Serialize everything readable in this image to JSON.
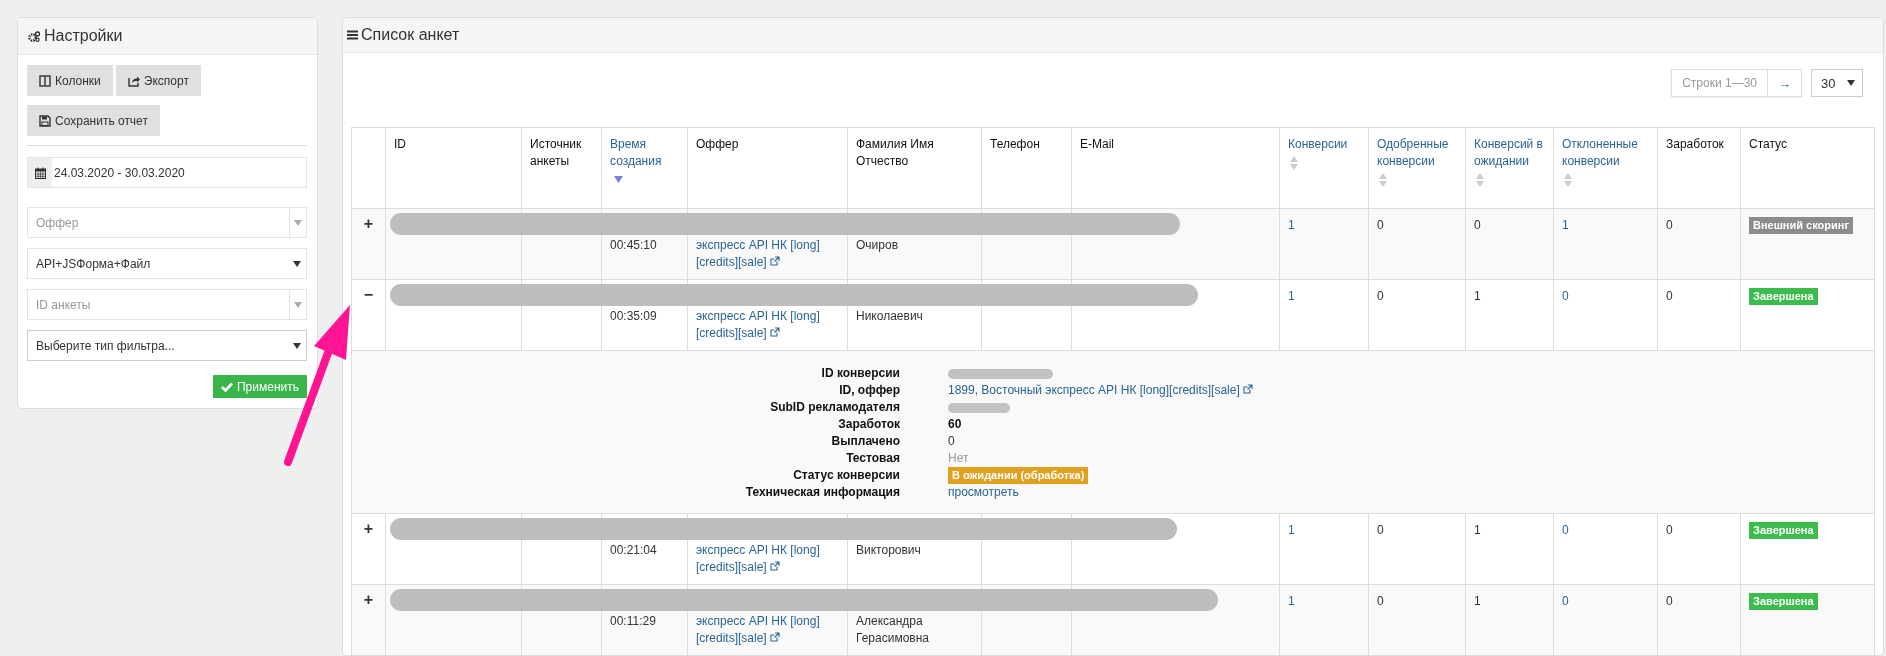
{
  "settings": {
    "title": "Настройки",
    "buttons": [
      {
        "label": "Колонки"
      },
      {
        "label": "Экспорт"
      },
      {
        "label": "Сохранить отчет"
      }
    ],
    "date_range": {
      "value": "24.03.2020 - 30.03.2020"
    },
    "filters": [
      {
        "kind": "search-select",
        "placeholder": "Оффер"
      },
      {
        "kind": "select",
        "value": "API+JSФорма+Файл"
      },
      {
        "kind": "search-select",
        "placeholder": "ID анкеты"
      },
      {
        "kind": "select",
        "value": "Выберите тип фильтра..."
      }
    ],
    "apply_button": "Применить"
  },
  "list": {
    "title": "Список анкет",
    "pager": {
      "label": "Строки 1—30",
      "next": "→"
    },
    "page_size": "30",
    "columns": [
      {},
      {
        "label": "ID"
      },
      {
        "label": "Источник анкеты"
      },
      {
        "label": "Время создания",
        "sortable": true,
        "sorted": true
      },
      {
        "label": "Оффер"
      },
      {
        "label": "Фамилия Имя Отчество"
      },
      {
        "label": "Телефон"
      },
      {
        "label": "E-Mail"
      },
      {
        "label": "Конверсии",
        "sortable": true,
        "sorted": false
      },
      {
        "label": "Одобренные конверсии",
        "sortable": true,
        "sorted": false
      },
      {
        "label": "Конверсий в ожидании",
        "sortable": true,
        "sorted": false
      },
      {
        "label": "Отклоненные конверсии",
        "sortable": true,
        "sorted": false
      },
      {
        "label": "Заработок"
      },
      {
        "label": "Статус"
      }
    ],
    "rows": [
      {
        "toggle": "+",
        "time": "00:45:10",
        "offer": "экспресс API НК [long] [credits][sale]",
        "name": "Очиров",
        "conversions": "1",
        "approved": "0",
        "pending": "0",
        "rejected": "1",
        "earnings": "0",
        "status": {
          "kind": "neutral",
          "text": "Внешний скоринг"
        }
      },
      {
        "toggle": "−",
        "time": "00:35:09",
        "offer": "экспресс API НК [long] [credits][sale]",
        "name": "Николаевич",
        "conversions": "1",
        "approved": "0",
        "pending": "1",
        "rejected": "0",
        "earnings": "0",
        "status": {
          "kind": "success",
          "text": "Завершена"
        },
        "details": [
          {
            "label": "ID конверсии",
            "kind": "redacted"
          },
          {
            "label": "ID, оффер",
            "kind": "link",
            "value": "1899, Восточный экспресс API НК [long][credits][sale]"
          },
          {
            "label": "SubID рекламодателя",
            "kind": "redacted"
          },
          {
            "label": "Заработок",
            "kind": "bold",
            "value": "60"
          },
          {
            "label": "Выплачено",
            "kind": "plain",
            "value": "0"
          },
          {
            "label": "Тестовая",
            "kind": "muted",
            "value": "Нет"
          },
          {
            "label": "Статус конверсии",
            "kind": "badge",
            "value": "В ожидании (обработка)"
          },
          {
            "label": "Техническая информация",
            "kind": "action",
            "value": "просмотреть"
          }
        ]
      },
      {
        "toggle": "+",
        "time": "00:21:04",
        "offer": "экспресс API НК [long] [credits][sale]",
        "name": "Викторович",
        "conversions": "1",
        "approved": "0",
        "pending": "1",
        "rejected": "0",
        "earnings": "0",
        "status": {
          "kind": "success",
          "text": "Завершена"
        }
      },
      {
        "toggle": "+",
        "time": "00:11:29",
        "offer": "экспресс API НК [long] [credits][sale]",
        "name": "Александра Герасимовна",
        "conversions": "1",
        "approved": "0",
        "pending": "1",
        "rejected": "0",
        "earnings": "0",
        "status": {
          "kind": "success",
          "text": "Завершена"
        }
      }
    ]
  }
}
